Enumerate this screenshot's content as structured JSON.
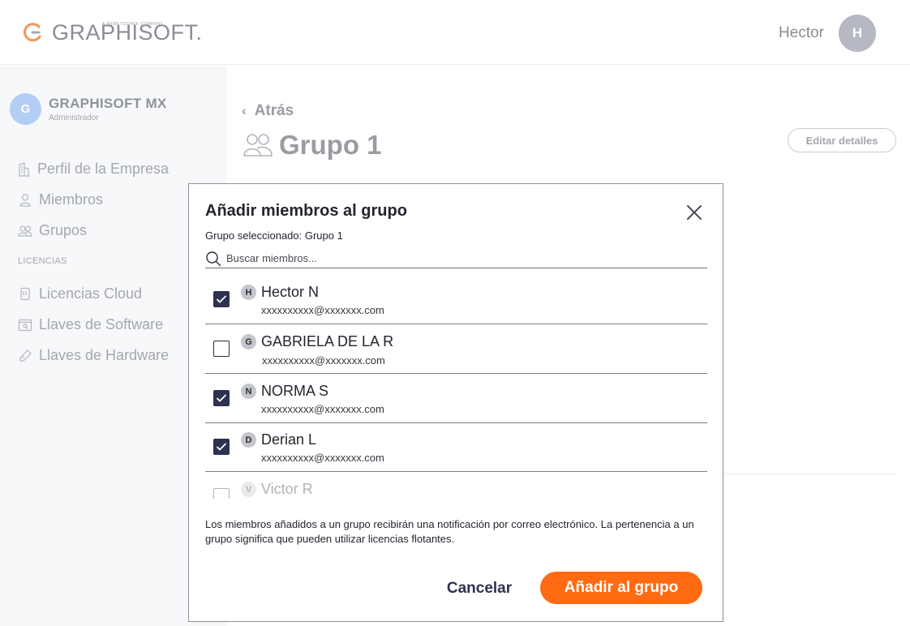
{
  "header": {
    "brand": "GRAPHISOFT.",
    "brand_sub": "A NEMETSCHEK COMPANY",
    "user_name": "Hector",
    "user_initial": "H"
  },
  "sidebar": {
    "company_initial": "G",
    "company_name": "GRAPHISOFT MX",
    "company_role": "Administrador",
    "items": [
      {
        "label": "Perfil de la Empresa",
        "icon": "building-icon"
      },
      {
        "label": "Miembros",
        "icon": "user-icon"
      },
      {
        "label": "Grupos",
        "icon": "group-icon"
      }
    ],
    "section_label": "LICENCIAS",
    "license_items": [
      {
        "label": "Licencias Cloud",
        "icon": "cloud-license-icon"
      },
      {
        "label": "Llaves de Software",
        "icon": "software-key-icon"
      },
      {
        "label": "Llaves de Hardware",
        "icon": "hardware-key-icon"
      }
    ]
  },
  "main": {
    "back_label": "Atrás",
    "title": "Grupo 1",
    "edit_label": "Editar detalles"
  },
  "modal": {
    "title": "Añadir miembros al grupo",
    "subtitle": "Grupo seleccionado: Grupo 1",
    "search_placeholder": "Buscar miembros...",
    "members": [
      {
        "initial": "H",
        "name": "Hector N",
        "email": "xxxxxxxxxx@xxxxxxx.com",
        "checked": true
      },
      {
        "initial": "G",
        "name": "GABRIELA DE LA R",
        "email": "xxxxxxxxxx@xxxxxxx.com",
        "checked": false
      },
      {
        "initial": "N",
        "name": "NORMA S",
        "email": "xxxxxxxxxx@xxxxxxx.com",
        "checked": true
      },
      {
        "initial": "D",
        "name": "Derian L",
        "email": "xxxxxxxxxx@xxxxxxx.com",
        "checked": true
      },
      {
        "initial": "V",
        "name": "Victor R",
        "email": "",
        "checked": false
      }
    ],
    "note": "Los miembros añadidos a un grupo recibirán una notificación por correo electrónico. La pertenencia a un grupo significa que pueden utilizar licencias flotantes.",
    "cancel_label": "Cancelar",
    "add_label": "Añadir al grupo"
  },
  "colors": {
    "accent": "#ff6b12",
    "checkbox": "#2e3150",
    "brand_orange": "#f39a5c"
  }
}
